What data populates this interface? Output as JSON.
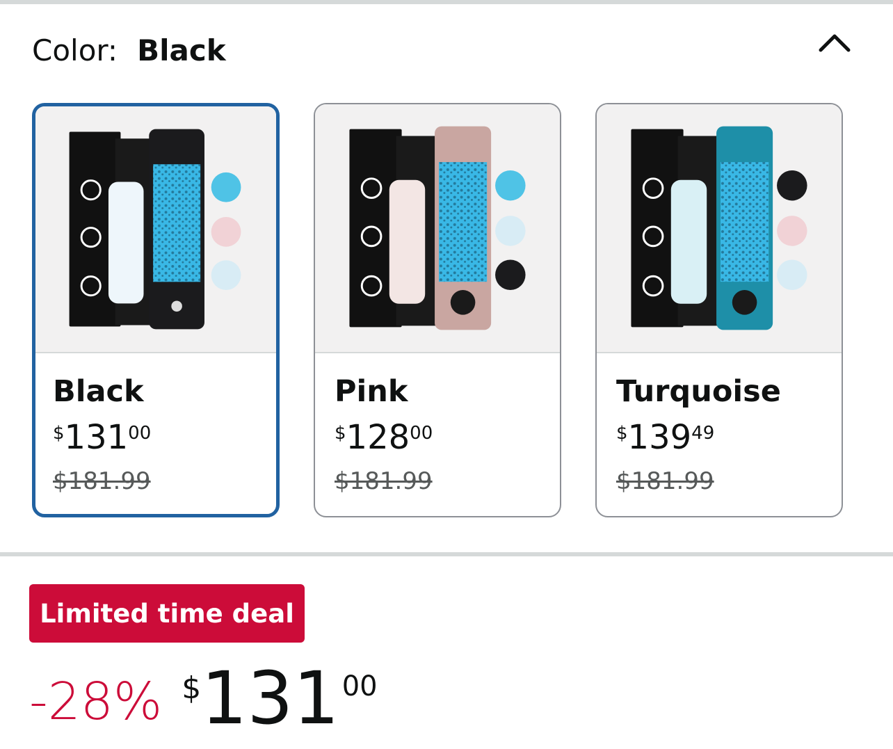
{
  "color_selector": {
    "label": "Color:",
    "selected_value": "Black",
    "collapse_icon": "chevron-up-icon"
  },
  "swatches": [
    {
      "name": "Black",
      "price_symbol": "$",
      "price_whole": "131",
      "price_fraction": "00",
      "list_price": "$181.99",
      "selected": true,
      "bottle_color": "#1b1b1d"
    },
    {
      "name": "Pink",
      "price_symbol": "$",
      "price_whole": "128",
      "price_fraction": "00",
      "list_price": "$181.99",
      "selected": false,
      "bottle_color": "#c9a6a1"
    },
    {
      "name": "Turquoise",
      "price_symbol": "$",
      "price_whole": "139",
      "price_fraction": "49",
      "list_price": "$181.99",
      "selected": false,
      "bottle_color": "#1e8fa8"
    }
  ],
  "deal": {
    "badge": "Limited time deal",
    "discount": "-28%",
    "price_symbol": "$",
    "price_whole": "131",
    "price_fraction": "00"
  },
  "colors": {
    "accent_selected": "#2162a1",
    "deal_red": "#cc0c39",
    "water_blue": "#39b8e6"
  }
}
